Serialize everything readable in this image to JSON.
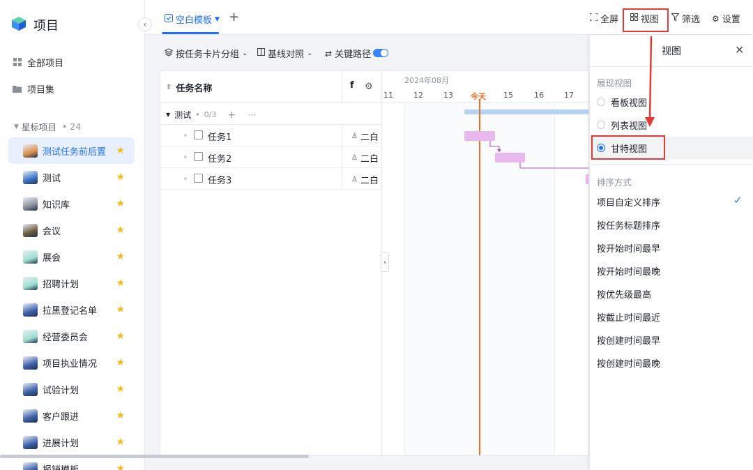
{
  "sidebar": {
    "app_title": "项目",
    "collapse_icon": "‹",
    "nav": [
      {
        "label": "全部项目",
        "icon": "grid-icon"
      },
      {
        "label": "项目集",
        "icon": "folder-icon"
      }
    ],
    "starred_label": "星标项目",
    "starred_count": "• 24",
    "projects": [
      {
        "label": "测试任务前后置",
        "thumb": "#d98f4a",
        "active": true
      },
      {
        "label": "测试",
        "thumb": "#3a72c8"
      },
      {
        "label": "知识库",
        "thumb": "#8a8f99"
      },
      {
        "label": "会议",
        "thumb": "#6b5a3c"
      },
      {
        "label": "展会",
        "thumb": "#9fe0d0"
      },
      {
        "label": "招聘计划",
        "thumb": "#9fe0d0"
      },
      {
        "label": "拉黑登记名单",
        "thumb": "#3b5fa8"
      },
      {
        "label": "经营委员会",
        "thumb": "#9fe0d0"
      },
      {
        "label": "项目执业情况",
        "thumb": "#3b5fa8"
      },
      {
        "label": "试验计划",
        "thumb": "#3b5fa8"
      },
      {
        "label": "客户跟进",
        "thumb": "#3b5fa8"
      },
      {
        "label": "进展计划",
        "thumb": "#3b5fa8"
      },
      {
        "label": "报销模板",
        "thumb": "#3b5fa8"
      }
    ]
  },
  "topbar": {
    "tab_label": "空白模板",
    "tab_add": "+",
    "actions": {
      "fullscreen": "全屏",
      "view": "视图",
      "filter": "筛选",
      "settings": "设置"
    }
  },
  "toolbar": {
    "group_by": "按任务卡片分组",
    "baseline": "基线对照",
    "critical_path": "关键路径"
  },
  "gantt": {
    "col_task_name": "任务名称",
    "col_second_clip": "f",
    "group_name": "测试",
    "group_progress": "0/3",
    "group_add": "+",
    "group_more": "···",
    "tasks": [
      {
        "name": "任务1",
        "owner": "二白"
      },
      {
        "name": "任务2",
        "owner": "二白"
      },
      {
        "name": "任务3",
        "owner": "二白"
      }
    ],
    "month_label": "2024年08月",
    "days": [
      "11",
      "12",
      "13",
      "今天",
      "15",
      "16",
      "17"
    ]
  },
  "panel": {
    "title": "视图",
    "display_section": "展现视图",
    "views": [
      {
        "label": "看板视图",
        "selected": false
      },
      {
        "label": "列表视图",
        "selected": false
      },
      {
        "label": "甘特视图",
        "selected": true
      }
    ],
    "sort_section": "排序方式",
    "sort_options": [
      "项目自定义排序",
      "按任务标题排序",
      "按开始时间最早",
      "按开始时间最晚",
      "按优先级最高",
      "按截止时间最近",
      "按创建时间最早",
      "按创建时间最晚"
    ],
    "sort_selected": "项目自定义排序"
  },
  "colors": {
    "accent": "#1f6fff",
    "today": "#f56c1f",
    "task_bar": "#e9b8ef",
    "annotation_red": "#e53935",
    "star": "#f7ba1e"
  }
}
